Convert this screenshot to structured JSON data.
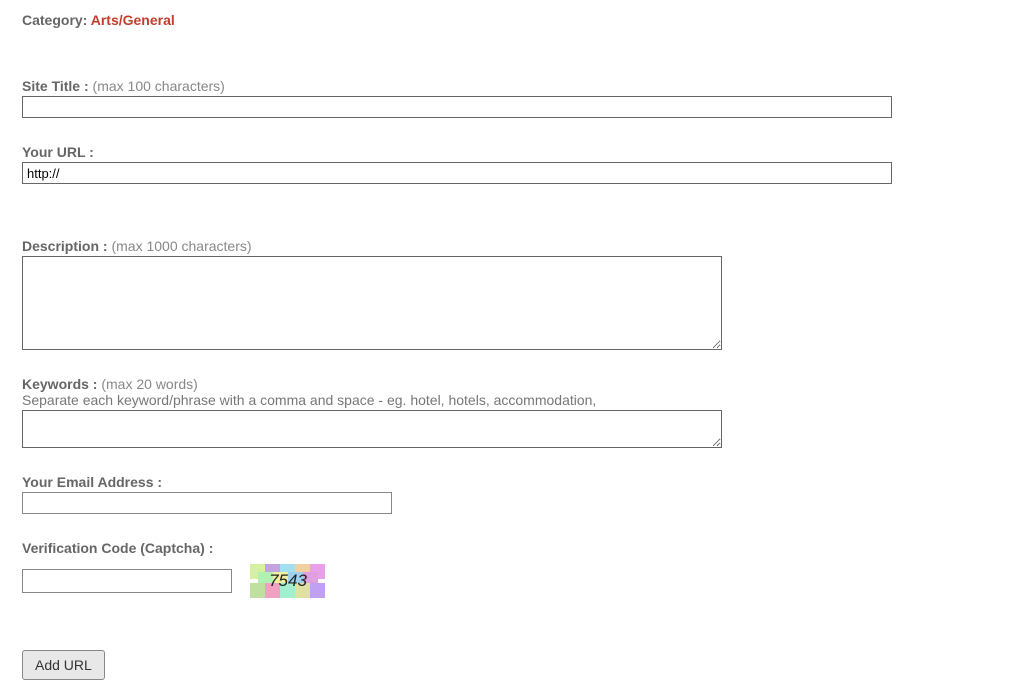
{
  "category": {
    "label": "Category: ",
    "value": "Arts/General"
  },
  "fields": {
    "site_title": {
      "label": "Site Title : ",
      "hint": "(max 100 characters)",
      "value": ""
    },
    "url": {
      "label": "Your URL :",
      "value": "http://"
    },
    "description": {
      "label": "Description : ",
      "hint": "(max 1000 characters)",
      "value": ""
    },
    "keywords": {
      "label": "Keywords : ",
      "hint": "(max 20 words)",
      "subhint": "Separate each keyword/phrase with a comma and space - eg. hotel, hotels, accommodation,",
      "value": ""
    },
    "email": {
      "label": "Your Email Address :",
      "value": ""
    },
    "captcha": {
      "label": "Verification Code (Captcha) :",
      "value": "",
      "code": "7543"
    }
  },
  "submit": {
    "label": "Add URL"
  }
}
